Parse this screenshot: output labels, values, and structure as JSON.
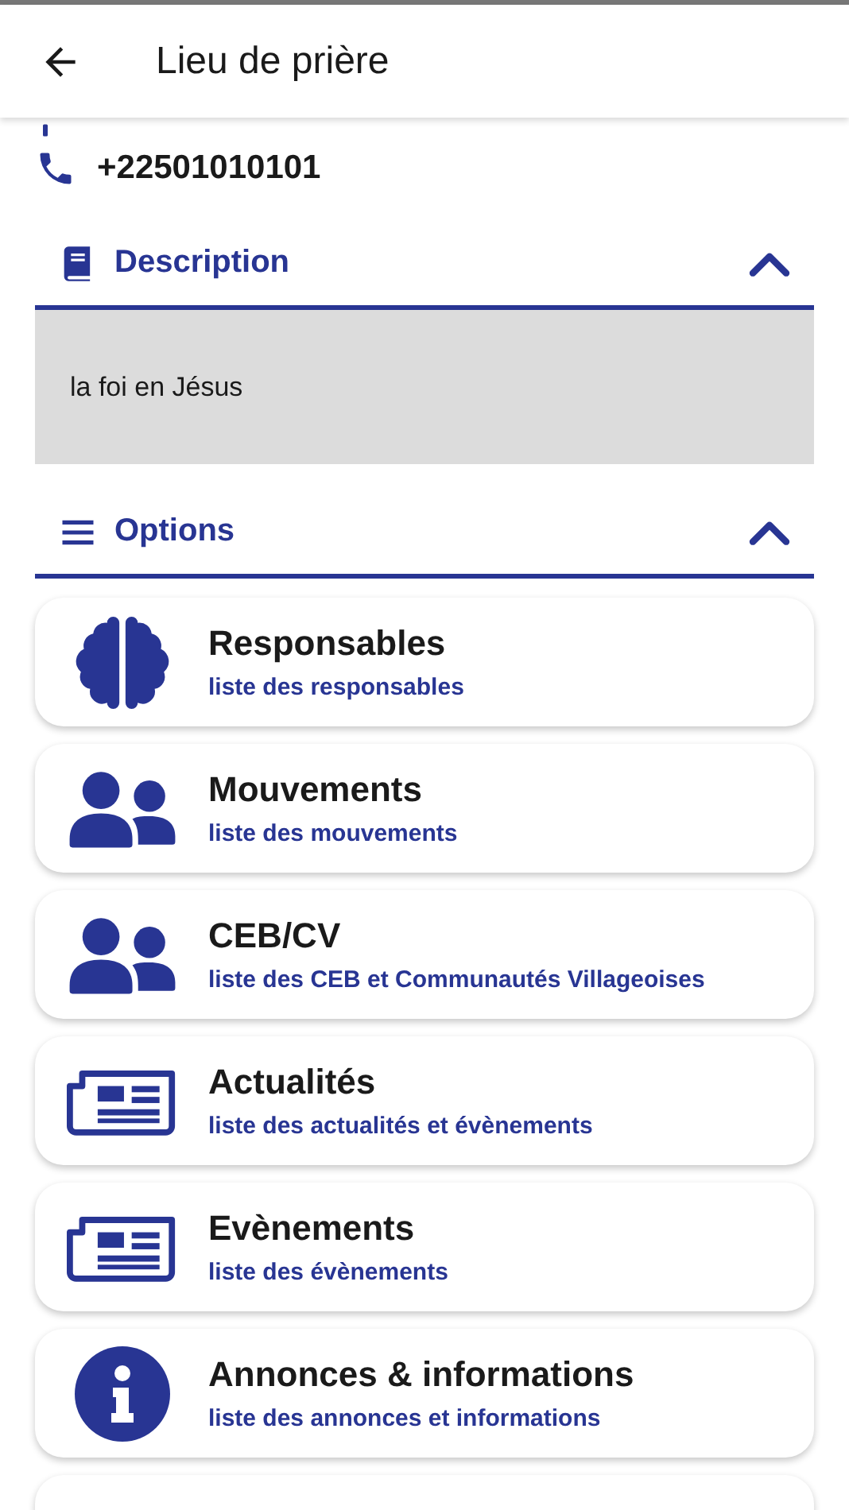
{
  "app_bar": {
    "title": "Lieu de prière"
  },
  "contact": {
    "phone": "+22501010101"
  },
  "sections": [
    {
      "title": "Description",
      "expanded": true,
      "body": "la foi en Jésus"
    },
    {
      "title": "Options",
      "expanded": true
    }
  ],
  "options": [
    {
      "title": "Responsables",
      "subtitle": "liste des responsables"
    },
    {
      "title": "Mouvements",
      "subtitle": "liste des mouvements"
    },
    {
      "title": "CEB/CV",
      "subtitle": "liste des CEB et Communautés Villageoises"
    },
    {
      "title": "Actualités",
      "subtitle": "liste des actualités et évènements"
    },
    {
      "title": "Evènements",
      "subtitle": "liste des évènements"
    },
    {
      "title": "Annonces & informations",
      "subtitle": "liste des annonces et informations"
    }
  ]
}
